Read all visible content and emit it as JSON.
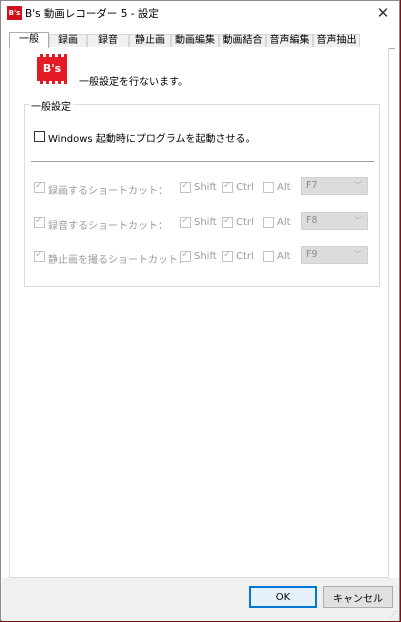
{
  "window": {
    "title": "B's 動画レコーダー 5 - 設定",
    "app_icon_text": "B's"
  },
  "tabs": [
    {
      "label": "一般",
      "active": true
    },
    {
      "label": "録画"
    },
    {
      "label": "録音"
    },
    {
      "label": "静止画"
    },
    {
      "label": "動画編集"
    },
    {
      "label": "動画結合"
    },
    {
      "label": "音声編集"
    },
    {
      "label": "音声抽出"
    }
  ],
  "logo_text": "B's",
  "description": "一般設定を行ないます。",
  "group": {
    "title": "一般設定",
    "startup_label": "Windows 起動時にプログラムを起動させる。",
    "startup_checked": false
  },
  "shortcuts": [
    {
      "label": "録画するショートカット：",
      "shift": "Shift",
      "ctrl": "Ctrl",
      "alt": "Alt",
      "key": "F7"
    },
    {
      "label": "録音するショートカット：",
      "shift": "Shift",
      "ctrl": "Ctrl",
      "alt": "Alt",
      "key": "F8"
    },
    {
      "label": "静止画を撮るショートカット：",
      "shift": "Shift",
      "ctrl": "Ctrl",
      "alt": "Alt",
      "key": "F9"
    }
  ],
  "buttons": {
    "ok": "OK",
    "cancel": "キャンセル"
  },
  "colors": {
    "brand": "#e21b24",
    "focus": "#0078d7"
  }
}
